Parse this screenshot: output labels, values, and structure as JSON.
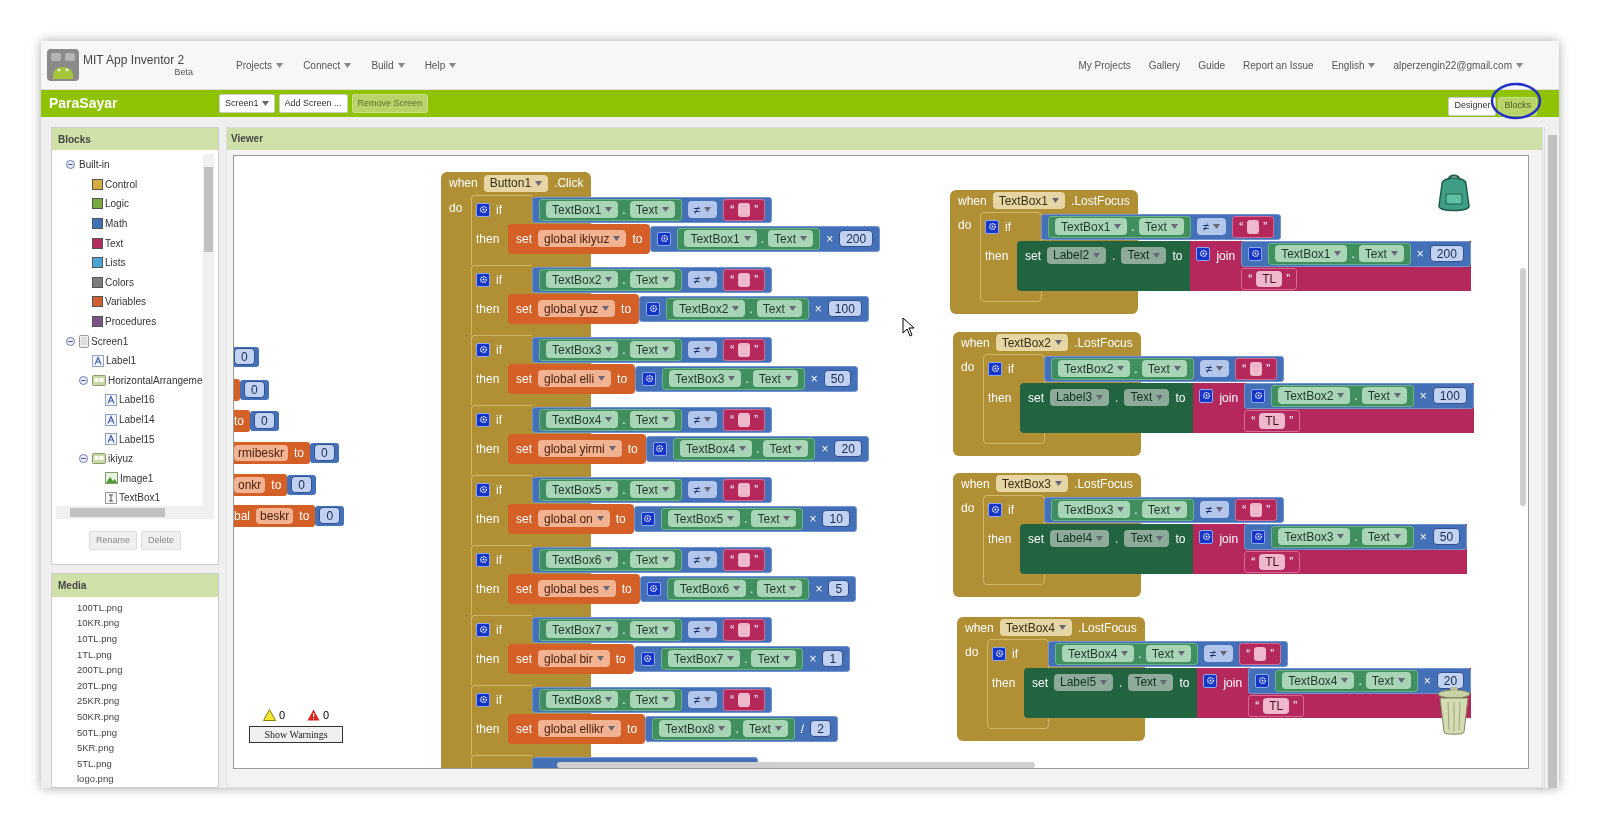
{
  "app": {
    "title": "MIT App Inventor 2",
    "subtitle": "Beta"
  },
  "menu": [
    {
      "label": "Projects",
      "dropdown": true
    },
    {
      "label": "Connect",
      "dropdown": true
    },
    {
      "label": "Build",
      "dropdown": true
    },
    {
      "label": "Help",
      "dropdown": true
    }
  ],
  "account_links": [
    {
      "label": "My Projects",
      "dropdown": false
    },
    {
      "label": "Gallery",
      "dropdown": false
    },
    {
      "label": "Guide",
      "dropdown": false
    },
    {
      "label": "Report an Issue",
      "dropdown": false
    },
    {
      "label": "English",
      "dropdown": true
    },
    {
      "label": "alperzengin22@gmail.com",
      "dropdown": true
    }
  ],
  "project": {
    "name": "ParaSayar",
    "buttons": [
      {
        "label": "Screen1",
        "dropdown": true,
        "disabled": false
      },
      {
        "label": "Add Screen ...",
        "dropdown": false,
        "disabled": false
      },
      {
        "label": "Remove Screen",
        "dropdown": false,
        "disabled": true
      }
    ],
    "views": [
      {
        "label": "Designer",
        "selected": false,
        "circled": false
      },
      {
        "label": "Blocks",
        "selected": true,
        "circled": true
      }
    ]
  },
  "blocks_panel": {
    "title": "Blocks",
    "tree": [
      {
        "label": "Built-in",
        "kind": "group",
        "expanded": true,
        "children": [
          {
            "label": "Control",
            "kind": "builtin",
            "color": "#d6ac3e"
          },
          {
            "label": "Logic",
            "kind": "builtin",
            "color": "#77ab41"
          },
          {
            "label": "Math",
            "kind": "builtin",
            "color": "#3f71b5"
          },
          {
            "label": "Text",
            "kind": "builtin",
            "color": "#b32d5e"
          },
          {
            "label": "Lists",
            "kind": "builtin",
            "color": "#49a6d4"
          },
          {
            "label": "Colors",
            "kind": "builtin",
            "color": "#7d7d7d"
          },
          {
            "label": "Variables",
            "kind": "builtin",
            "color": "#d05f2d"
          },
          {
            "label": "Procedures",
            "kind": "builtin",
            "color": "#7c5385"
          }
        ]
      },
      {
        "label": "Screen1",
        "kind": "screen",
        "expanded": true,
        "children": [
          {
            "label": "Label1",
            "kind": "label"
          },
          {
            "label": "HorizontalArrangeme",
            "kind": "arrangement",
            "expanded": true,
            "children": [
              {
                "label": "Label16",
                "kind": "label"
              },
              {
                "label": "Label14",
                "kind": "label"
              },
              {
                "label": "Label15",
                "kind": "label"
              }
            ]
          },
          {
            "label": "ikiyuz",
            "kind": "arrangement",
            "expanded": true,
            "children": [
              {
                "label": "Image1",
                "kind": "image"
              },
              {
                "label": "TextBox1",
                "kind": "textbox"
              }
            ]
          }
        ]
      }
    ],
    "buttons": [
      {
        "label": "Rename",
        "disabled": true
      },
      {
        "label": "Delete",
        "disabled": true
      }
    ]
  },
  "media": {
    "title": "Media",
    "files": [
      "100TL.png",
      "10KR.png",
      "10TL.png",
      "1TL.png",
      "200TL.png",
      "20TL.png",
      "25KR.png",
      "50KR.png",
      "50TL.png",
      "5KR.png",
      "5TL.png",
      "logo.png"
    ]
  },
  "viewer": {
    "title": "Viewer",
    "partial_blocks": [
      {
        "kind": "number",
        "number": "0"
      },
      {
        "kind": "setter",
        "number": "0"
      },
      {
        "kind": "setter",
        "to": "to",
        "number": "0"
      },
      {
        "kind": "setter",
        "variable": "rmibeskr",
        "to": "to",
        "number": "0"
      },
      {
        "kind": "setter",
        "variable": "onkr",
        "to": "to",
        "number": "0"
      },
      {
        "kind": "setter",
        "prefix": "bal",
        "variable": "beskr",
        "to": "to",
        "number": "0"
      }
    ],
    "click_event": {
      "when": "when",
      "component": "Button1",
      "event": ".Click",
      "do": "do",
      "statements": [
        {
          "kind": "if",
          "if": "if",
          "then": "then",
          "test": {
            "getter": {
              "component": "TextBox1",
              "dot": ".",
              "property": "Text"
            },
            "operator": "≠",
            "string": {
              "open": "“",
              "close": "”"
            }
          },
          "action": {
            "set": "set",
            "variable": "global ikiyuz",
            "to": "to",
            "math": {
              "mutator": true,
              "getter": {
                "component": "TextBox1",
                "dot": ".",
                "property": "Text"
              },
              "operator": "×",
              "number": "200"
            }
          }
        },
        {
          "kind": "if",
          "if": "if",
          "then": "then",
          "test": {
            "getter": {
              "component": "TextBox2",
              "dot": ".",
              "property": "Text"
            },
            "operator": "≠",
            "string": {
              "open": "“",
              "close": "”"
            }
          },
          "action": {
            "set": "set",
            "variable": "global yuz",
            "to": "to",
            "math": {
              "mutator": true,
              "getter": {
                "component": "TextBox2",
                "dot": ".",
                "property": "Text"
              },
              "operator": "×",
              "number": "100"
            }
          }
        },
        {
          "kind": "if",
          "if": "if",
          "then": "then",
          "test": {
            "getter": {
              "component": "TextBox3",
              "dot": ".",
              "property": "Text"
            },
            "operator": "≠",
            "string": {
              "open": "“",
              "close": "”"
            }
          },
          "action": {
            "set": "set",
            "variable": "global elli",
            "to": "to",
            "math": {
              "mutator": true,
              "getter": {
                "component": "TextBox3",
                "dot": ".",
                "property": "Text"
              },
              "operator": "×",
              "number": "50"
            }
          }
        },
        {
          "kind": "if",
          "if": "if",
          "then": "then",
          "test": {
            "getter": {
              "component": "TextBox4",
              "dot": ".",
              "property": "Text"
            },
            "operator": "≠",
            "string": {
              "open": "“",
              "close": "”"
            }
          },
          "action": {
            "set": "set",
            "variable": "global yirmi",
            "to": "to",
            "math": {
              "mutator": true,
              "getter": {
                "component": "TextBox4",
                "dot": ".",
                "property": "Text"
              },
              "operator": "×",
              "number": "20"
            }
          }
        },
        {
          "kind": "if",
          "if": "if",
          "then": "then",
          "test": {
            "getter": {
              "component": "TextBox5",
              "dot": ".",
              "property": "Text"
            },
            "operator": "≠",
            "string": {
              "open": "“",
              "close": "”"
            }
          },
          "action": {
            "set": "set",
            "variable": "global on",
            "to": "to",
            "math": {
              "mutator": true,
              "getter": {
                "component": "TextBox5",
                "dot": ".",
                "property": "Text"
              },
              "operator": "×",
              "number": "10"
            }
          }
        },
        {
          "kind": "if",
          "if": "if",
          "then": "then",
          "test": {
            "getter": {
              "component": "TextBox6",
              "dot": ".",
              "property": "Text"
            },
            "operator": "≠",
            "string": {
              "open": "“",
              "close": "”"
            }
          },
          "action": {
            "set": "set",
            "variable": "global bes",
            "to": "to",
            "math": {
              "mutator": true,
              "getter": {
                "component": "TextBox6",
                "dot": ".",
                "property": "Text"
              },
              "operator": "×",
              "number": "5"
            }
          }
        },
        {
          "kind": "if",
          "if": "if",
          "then": "then",
          "test": {
            "getter": {
              "component": "TextBox7",
              "dot": ".",
              "property": "Text"
            },
            "operator": "≠",
            "string": {
              "open": "“",
              "close": "”"
            }
          },
          "action": {
            "set": "set",
            "variable": "global bir",
            "to": "to",
            "math": {
              "mutator": true,
              "getter": {
                "component": "TextBox7",
                "dot": ".",
                "property": "Text"
              },
              "operator": "×",
              "number": "1"
            }
          }
        },
        {
          "kind": "if",
          "if": "if",
          "then": "then",
          "test": {
            "getter": {
              "component": "TextBox8",
              "dot": ".",
              "property": "Text"
            },
            "operator": "≠",
            "string": {
              "open": "“",
              "close": "”"
            }
          },
          "action": {
            "set": "set",
            "variable": "global ellikr",
            "to": "to",
            "math": {
              "mutator": false,
              "getter": {
                "component": "TextBox8",
                "dot": ".",
                "property": "Text"
              },
              "operator": "/",
              "number": "2"
            }
          }
        },
        {
          "kind": "cut"
        }
      ]
    },
    "focus_events": [
      {
        "when": "when",
        "component": "TextBox1",
        "event": ".LostFocus",
        "do": "do",
        "if": "if",
        "then": "then",
        "test": {
          "getter": {
            "component": "TextBox1",
            "dot": ".",
            "property": "Text"
          },
          "operator": "≠",
          "string": {
            "open": "“",
            "close": "”"
          }
        },
        "action": {
          "set": "set",
          "target": {
            "component": "Label2",
            "dot": ".",
            "property": "Text"
          },
          "to": "to",
          "join": {
            "label": "join",
            "math": {
              "mutator": true,
              "getter": {
                "component": "TextBox1",
                "dot": ".",
                "property": "Text"
              },
              "operator": "×",
              "number": "200"
            },
            "string": {
              "open": "“",
              "text": "TL",
              "close": "”"
            }
          }
        }
      },
      {
        "when": "when",
        "component": "TextBox2",
        "event": ".LostFocus",
        "do": "do",
        "if": "if",
        "then": "then",
        "test": {
          "getter": {
            "component": "TextBox2",
            "dot": ".",
            "property": "Text"
          },
          "operator": "≠",
          "string": {
            "open": "“",
            "close": "”"
          }
        },
        "action": {
          "set": "set",
          "target": {
            "component": "Label3",
            "dot": ".",
            "property": "Text"
          },
          "to": "to",
          "join": {
            "label": "join",
            "math": {
              "mutator": true,
              "getter": {
                "component": "TextBox2",
                "dot": ".",
                "property": "Text"
              },
              "operator": "×",
              "number": "100"
            },
            "string": {
              "open": "“",
              "text": "TL",
              "close": "”"
            }
          }
        }
      },
      {
        "when": "when",
        "component": "TextBox3",
        "event": ".LostFocus",
        "do": "do",
        "if": "if",
        "then": "then",
        "test": {
          "getter": {
            "component": "TextBox3",
            "dot": ".",
            "property": "Text"
          },
          "operator": "≠",
          "string": {
            "open": "“",
            "close": "”"
          }
        },
        "action": {
          "set": "set",
          "target": {
            "component": "Label4",
            "dot": ".",
            "property": "Text"
          },
          "to": "to",
          "join": {
            "label": "join",
            "math": {
              "mutator": true,
              "getter": {
                "component": "TextBox3",
                "dot": ".",
                "property": "Text"
              },
              "operator": "×",
              "number": "50"
            },
            "string": {
              "open": "“",
              "text": "TL",
              "close": "”"
            }
          }
        }
      },
      {
        "when": "when",
        "component": "TextBox4",
        "event": ".LostFocus",
        "do": "do",
        "if": "if",
        "then": "then",
        "test": {
          "getter": {
            "component": "TextBox4",
            "dot": ".",
            "property": "Text"
          },
          "operator": "≠",
          "string": {
            "open": "“",
            "close": "”"
          }
        },
        "action": {
          "set": "set",
          "target": {
            "component": "Label5",
            "dot": ".",
            "property": "Text"
          },
          "to": "to",
          "join": {
            "label": "join",
            "math": {
              "mutator": true,
              "getter": {
                "component": "TextBox4",
                "dot": ".",
                "property": "Text"
              },
              "operator": "×",
              "number": "20"
            },
            "string": {
              "open": "“",
              "text": "TL",
              "close": "”"
            }
          }
        }
      }
    ],
    "warnings": {
      "warning_count": "0",
      "error_count": "0",
      "button": "Show Warnings"
    }
  }
}
